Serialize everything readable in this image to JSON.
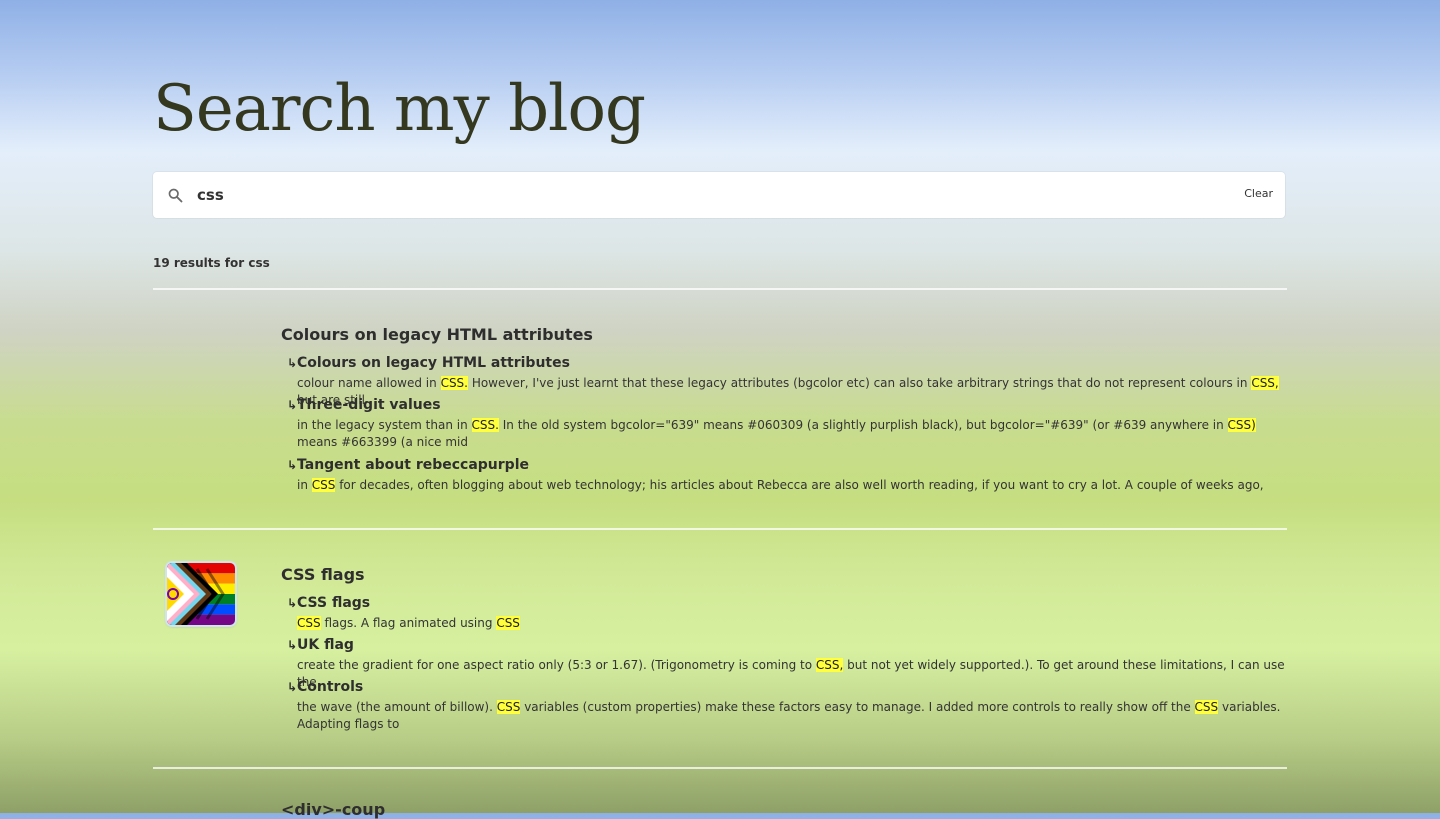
{
  "page": {
    "title": "Search my blog"
  },
  "search": {
    "value": "css",
    "clear_label": "Clear"
  },
  "results_summary": "19 results for css",
  "results": [
    {
      "title": "Colours on legacy HTML attributes",
      "has_thumbnail": false,
      "sections": [
        {
          "heading": "Colours on legacy HTML attributes",
          "snippet": [
            {
              "t": "colour name allowed in "
            },
            {
              "m": "CSS."
            },
            {
              "t": " However, I've just learnt that these legacy attributes (bgcolor etc) can also take arbitrary strings that do not represent colours in "
            },
            {
              "m": "CSS,"
            },
            {
              "t": " but are still"
            }
          ]
        },
        {
          "heading": "Three-digit values",
          "snippet": [
            {
              "t": "in the legacy system than in "
            },
            {
              "m": "CSS."
            },
            {
              "t": " In the old system bgcolor=\"639\" means #060309 (a slightly purplish black), but bgcolor=\"#639\" (or #639 anywhere in "
            },
            {
              "m": "CSS)"
            },
            {
              "t": " means #663399 (a nice mid"
            }
          ]
        },
        {
          "heading": "Tangent about rebeccapurple",
          "snippet": [
            {
              "t": "in "
            },
            {
              "m": "CSS"
            },
            {
              "t": " for decades, often blogging about web technology; his articles about Rebecca are also well worth reading, if you want to cry a lot. A couple of weeks ago,"
            }
          ]
        }
      ]
    },
    {
      "title": "CSS flags",
      "has_thumbnail": true,
      "thumbnail_icon": "progress-pride-flag-icon",
      "sections": [
        {
          "heading": "CSS flags",
          "snippet": [
            {
              "m": "CSS"
            },
            {
              "t": " flags. A flag animated using "
            },
            {
              "m": "CSS"
            }
          ]
        },
        {
          "heading": "UK flag",
          "snippet": [
            {
              "t": "create the gradient for one aspect ratio only (5:3 or 1.67). (Trigonometry is coming to "
            },
            {
              "m": "CSS,"
            },
            {
              "t": " but not yet widely supported.). To get around these limitations, I can use the"
            }
          ]
        },
        {
          "heading": "Controls",
          "snippet": [
            {
              "t": "the wave (the amount of billow). "
            },
            {
              "m": "CSS"
            },
            {
              "t": " variables (custom properties) make these factors easy to manage. I added more controls to really show off the "
            },
            {
              "m": "CSS"
            },
            {
              "t": " variables. Adapting flags to"
            }
          ]
        }
      ]
    },
    {
      "title": "<div>-coup",
      "has_thumbnail": false,
      "sections": []
    }
  ],
  "sub_arrow": "↳",
  "colors": {
    "highlight": "#ffff3c",
    "title_text": "#34381f",
    "sky_top": "#8fb0e6",
    "grass": "#c6de80"
  }
}
